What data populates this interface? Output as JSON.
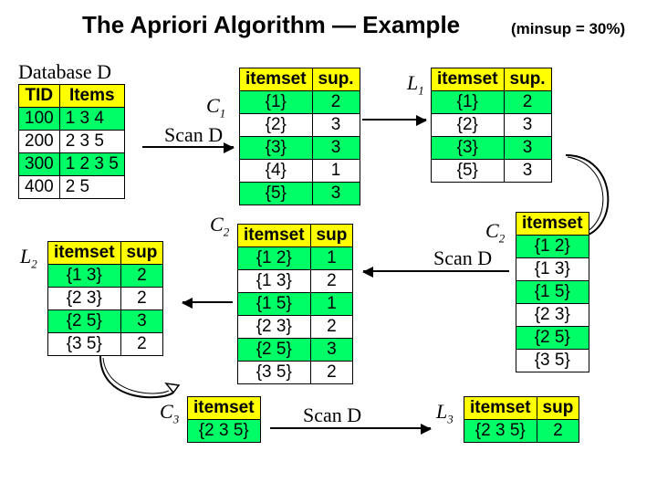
{
  "title": "The Apriori Algorithm — Example",
  "minsup": "(minsup = 30%)",
  "labels": {
    "databaseD": "Database D",
    "scanD": "Scan D",
    "C1": "C",
    "C1sub": "1",
    "L1": "L",
    "L1sub": "1",
    "C2": "C",
    "C2sub": "2",
    "L2": "L",
    "L2sub": "2",
    "C3": "C",
    "C3sub": "3",
    "L3": "L",
    "L3sub": "3"
  },
  "tables": {
    "D": {
      "headers": [
        "TID",
        "Items"
      ],
      "rows": [
        [
          "100",
          "1 3 4"
        ],
        [
          "200",
          "2 3 5"
        ],
        [
          "300",
          "1 2 3 5"
        ],
        [
          "400",
          "2 5"
        ]
      ]
    },
    "C1": {
      "headers": [
        "itemset",
        "sup."
      ],
      "rows": [
        [
          "{1}",
          "2"
        ],
        [
          "{2}",
          "3"
        ],
        [
          "{3}",
          "3"
        ],
        [
          "{4}",
          "1"
        ],
        [
          "{5}",
          "3"
        ]
      ]
    },
    "L1": {
      "headers": [
        "itemset",
        "sup."
      ],
      "rows": [
        [
          "{1}",
          "2"
        ],
        [
          "{2}",
          "3"
        ],
        [
          "{3}",
          "3"
        ],
        [
          "{5}",
          "3"
        ]
      ]
    },
    "C2cand": {
      "headers": [
        "itemset"
      ],
      "rows": [
        [
          "{1 2}"
        ],
        [
          "{1 3}"
        ],
        [
          "{1 5}"
        ],
        [
          "{2 3}"
        ],
        [
          "{2 5}"
        ],
        [
          "{3 5}"
        ]
      ]
    },
    "C2sup": {
      "headers": [
        "itemset",
        "sup"
      ],
      "rows": [
        [
          "{1 2}",
          "1"
        ],
        [
          "{1 3}",
          "2"
        ],
        [
          "{1 5}",
          "1"
        ],
        [
          "{2 3}",
          "2"
        ],
        [
          "{2 5}",
          "3"
        ],
        [
          "{3 5}",
          "2"
        ]
      ]
    },
    "L2": {
      "headers": [
        "itemset",
        "sup"
      ],
      "rows": [
        [
          "{1 3}",
          "2"
        ],
        [
          "{2 3}",
          "2"
        ],
        [
          "{2 5}",
          "3"
        ],
        [
          "{3 5}",
          "2"
        ]
      ]
    },
    "C3": {
      "headers": [
        "itemset"
      ],
      "rows": [
        [
          "{2 3 5}"
        ]
      ]
    },
    "L3": {
      "headers": [
        "itemset",
        "sup"
      ],
      "rows": [
        [
          "{2 3 5}",
          "2"
        ]
      ]
    }
  }
}
